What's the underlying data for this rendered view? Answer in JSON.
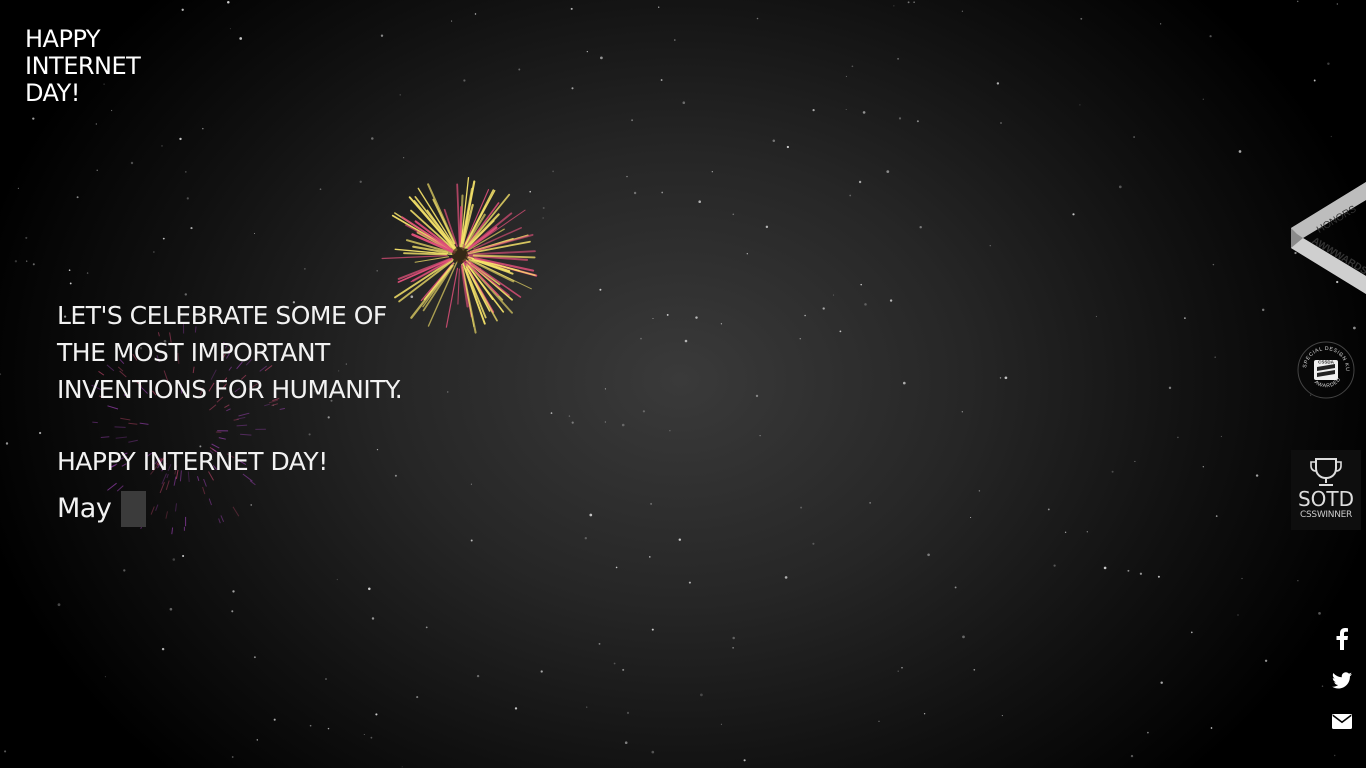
{
  "logo": {
    "lines": [
      "HAPPY",
      "INTERNET",
      "DAY!"
    ]
  },
  "intro": {
    "lines": [
      "LET'S CELEBRATE SOME OF",
      "THE MOST IMPORTANT",
      "INVENTIONS FOR HUMANITY."
    ],
    "greeting": "HAPPY INTERNET DAY!",
    "date_text": "May"
  },
  "badges": {
    "awwwards": {
      "top": "HONORS",
      "bottom": "AWWWARDS"
    },
    "cssda": {
      "outer_top": "SPECIAL DESIGN KUDOS",
      "center": "CSSDA",
      "outer_bottom": "AWARDED"
    },
    "csswinner": {
      "title": "SOTD",
      "subtitle": "CSSWINNER"
    }
  },
  "social": [
    {
      "name": "facebook-icon",
      "glyph": "f"
    },
    {
      "name": "twitter-icon"
    },
    {
      "name": "mail-icon"
    }
  ],
  "colors": {
    "background_center": "#3a3a3a",
    "background_edge": "#000000",
    "firework_primary": "#f7e46a",
    "firework_secondary": "#e0507a",
    "firework_faded": "#b44ad0"
  }
}
